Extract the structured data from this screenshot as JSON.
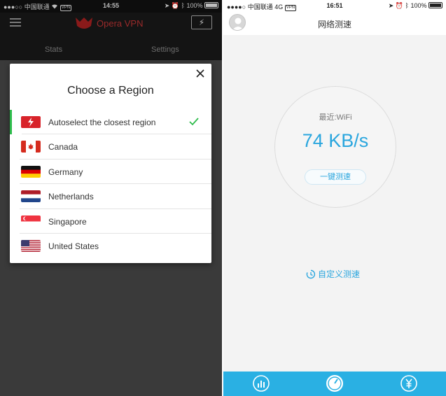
{
  "left_phone": {
    "status_bar": {
      "carrier": "中国联通",
      "vpn_tag": "VPN",
      "time": "14:55",
      "battery": "100%"
    },
    "app_bar": {
      "title": "Opera VPN",
      "tabs": [
        {
          "label": "Stats"
        },
        {
          "label": "Settings"
        }
      ]
    },
    "region_dialog": {
      "title": "Choose a Region",
      "regions": [
        {
          "label": "Autoselect the closest region",
          "flag": "lightning-icon",
          "selected": true
        },
        {
          "label": "Canada",
          "flag": "canada-flag-icon"
        },
        {
          "label": "Germany",
          "flag": "germany-flag-icon"
        },
        {
          "label": "Netherlands",
          "flag": "netherlands-flag-icon"
        },
        {
          "label": "Singapore",
          "flag": "singapore-flag-icon"
        },
        {
          "label": "United States",
          "flag": "united-states-flag-icon"
        }
      ]
    }
  },
  "right_phone": {
    "status_bar": {
      "carrier": "中国联通",
      "network": "4G",
      "vpn_tag": "VPN",
      "time": "16:51",
      "battery": "100%"
    },
    "header": {
      "title": "网络测速"
    },
    "speed_gauge": {
      "subtitle": "最近:WiFi",
      "speed": "74 KB/s",
      "button_label": "一键测速"
    },
    "custom_test_label": "自定义测速",
    "bottom_nav": [
      {
        "icon": "chart-icon"
      },
      {
        "icon": "speedometer-icon"
      },
      {
        "icon": "yuan-icon"
      }
    ]
  },
  "colors": {
    "accent_blue": "#2aa6de",
    "nav_blue": "#2ab0e3",
    "check_green": "#2dbb4b",
    "opera_red": "#cc1f26"
  }
}
